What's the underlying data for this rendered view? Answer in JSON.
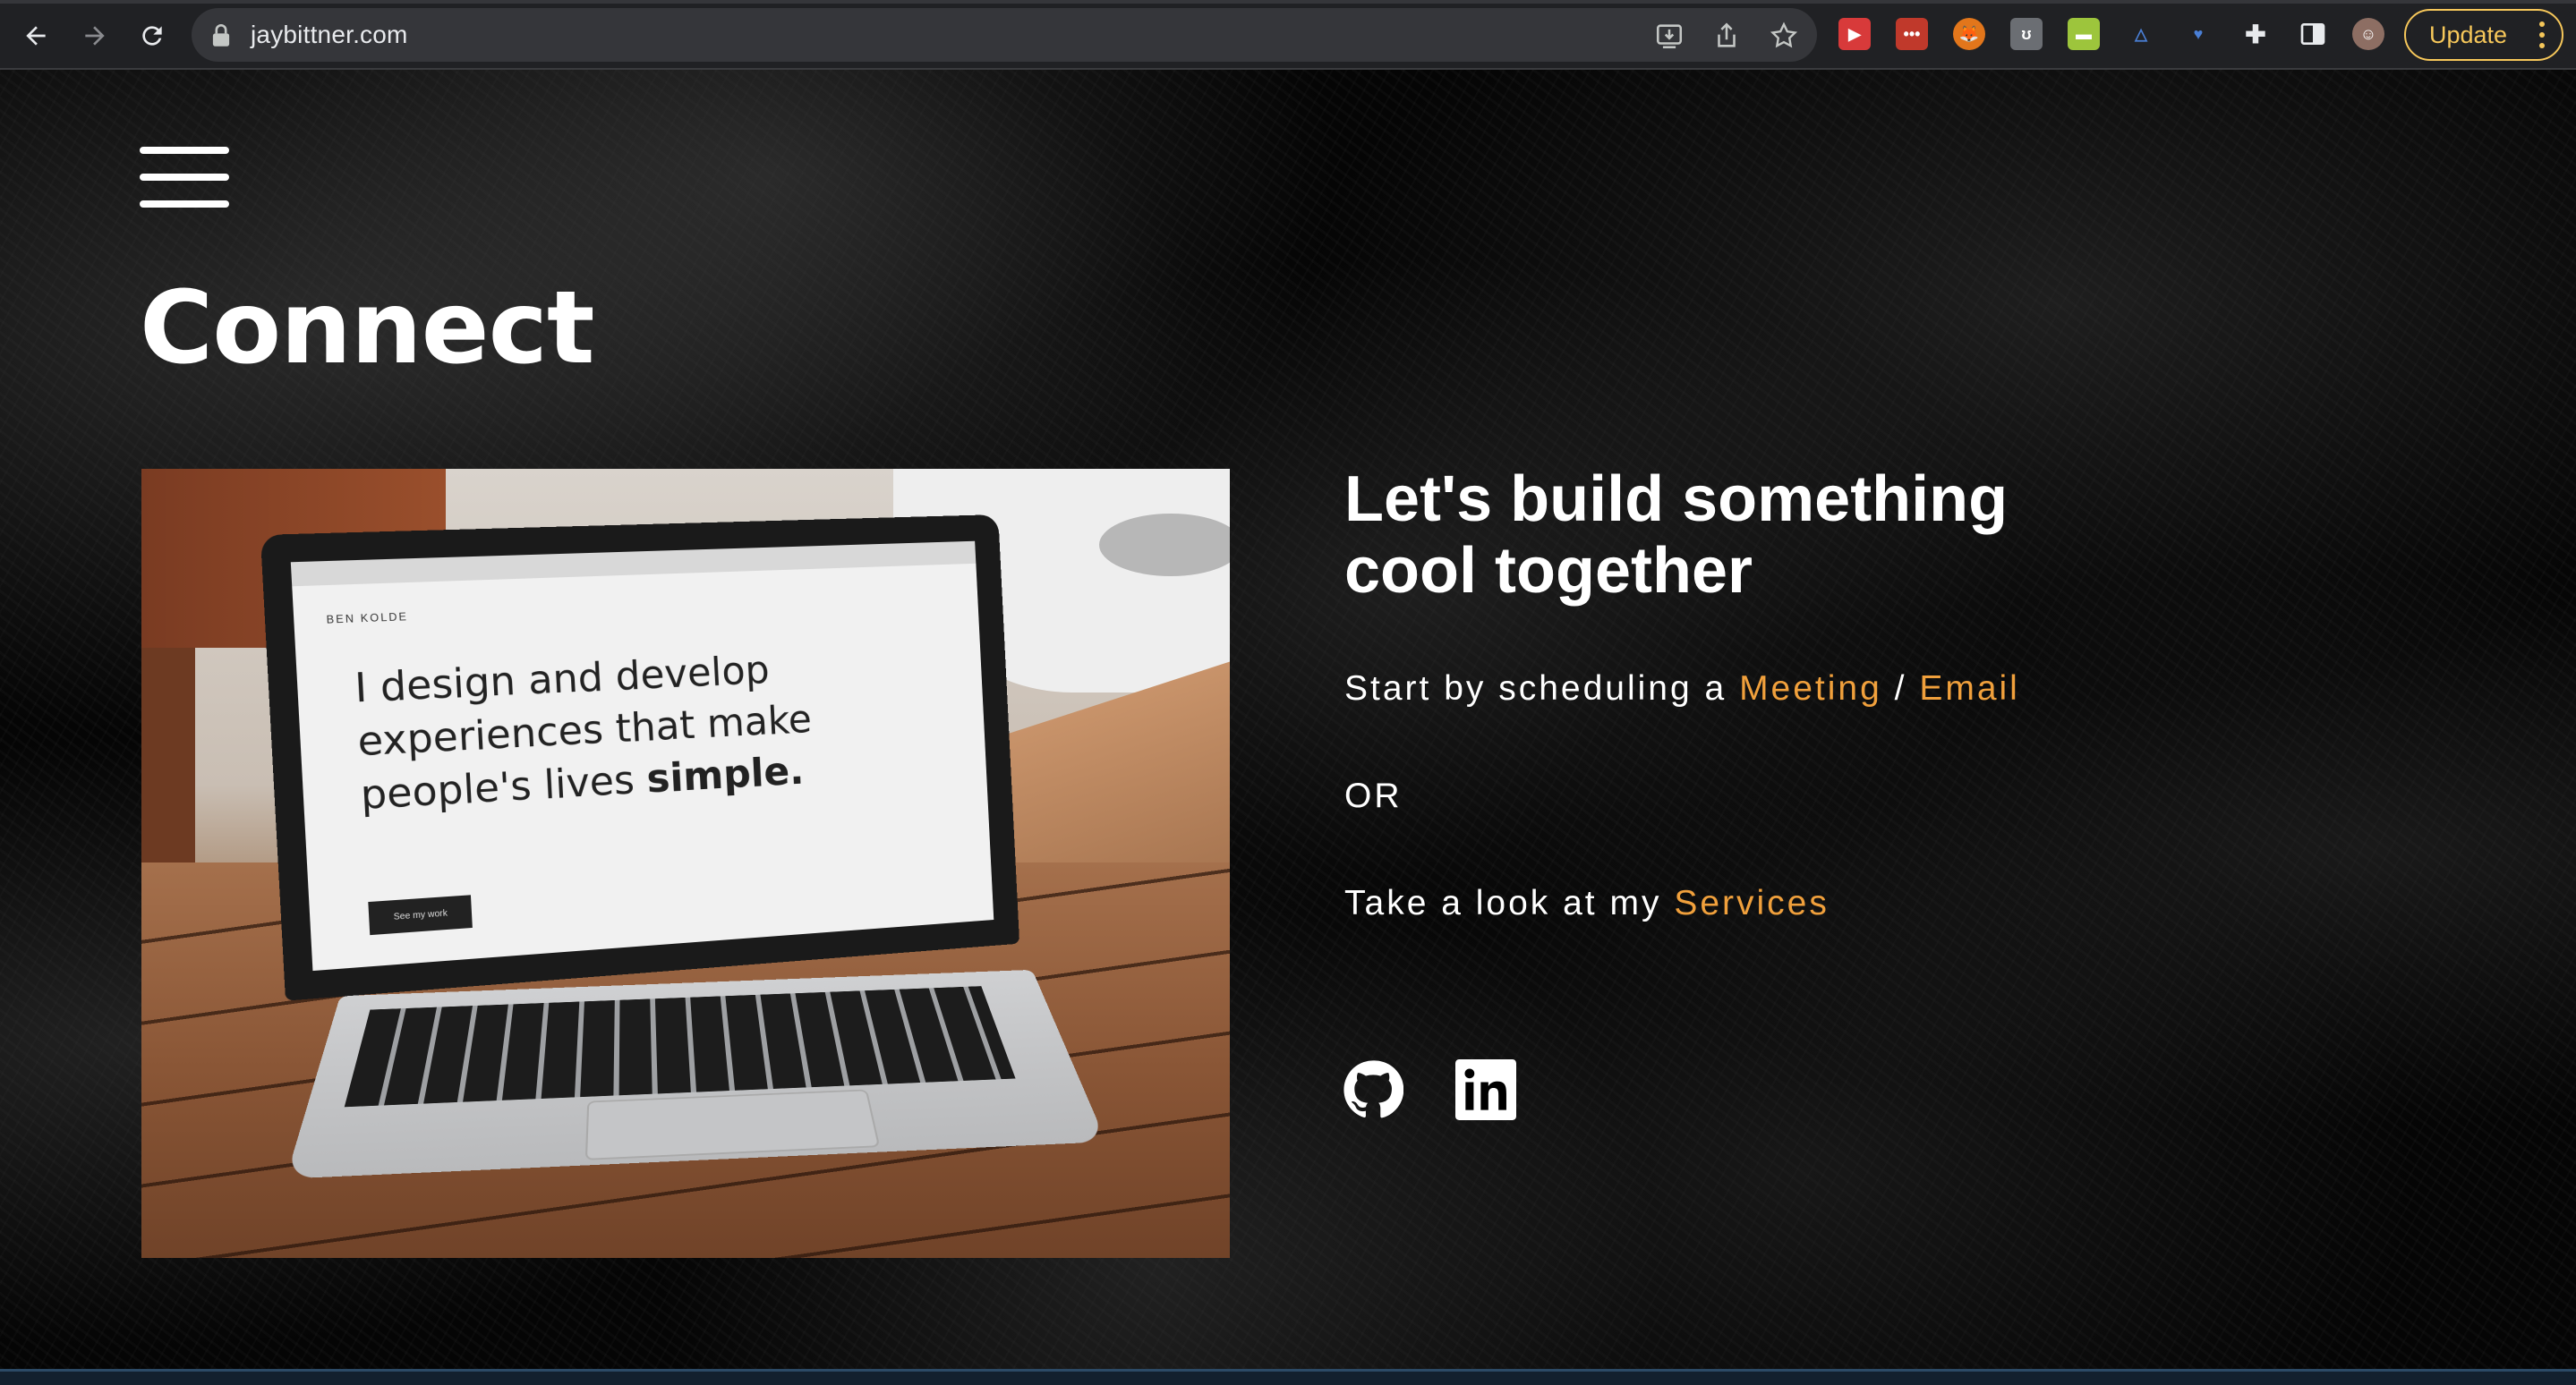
{
  "browser": {
    "url": "jaybittner.com",
    "update_label": "Update"
  },
  "page": {
    "title": "Connect",
    "heading_line1": "Let's build something",
    "heading_line2": "cool together",
    "schedule_prefix": "Start by scheduling a ",
    "meeting_link": "Meeting",
    "separator": " / ",
    "email_link": "Email",
    "or_text": "OR",
    "services_prefix": "Take a look at my ",
    "services_link": "Services",
    "accent_color": "#f0a03c"
  },
  "photo": {
    "brand": "BEN KOLDE",
    "headline_part1": "I design and develop experiences that make people's lives ",
    "headline_bold": "simple.",
    "button": "See my work"
  },
  "social": {
    "icons": [
      "github-icon",
      "linkedin-icon"
    ]
  }
}
